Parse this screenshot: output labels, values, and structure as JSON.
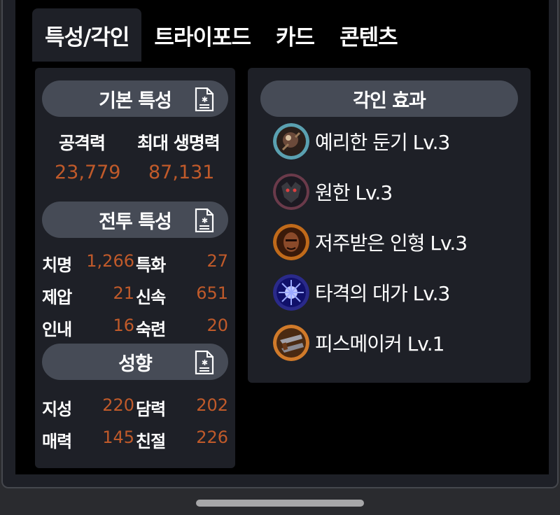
{
  "tabs": [
    {
      "label": "특성/각인",
      "active": true
    },
    {
      "label": "트라이포드",
      "active": false
    },
    {
      "label": "카드",
      "active": false
    },
    {
      "label": "콘텐츠",
      "active": false
    }
  ],
  "basic": {
    "title": "기본 특성",
    "attack_label": "공격력",
    "attack_value": "23,779",
    "hp_label": "최대 생명력",
    "hp_value": "87,131"
  },
  "combat": {
    "title": "전투 특성",
    "rows": [
      {
        "l1": "치명",
        "v1": "1,266",
        "l2": "특화",
        "v2": "27"
      },
      {
        "l1": "제압",
        "v1": "21",
        "l2": "신속",
        "v2": "651"
      },
      {
        "l1": "인내",
        "v1": "16",
        "l2": "숙련",
        "v2": "20"
      }
    ]
  },
  "tendency": {
    "title": "성향",
    "rows": [
      {
        "l1": "지성",
        "v1": "220",
        "l2": "담력",
        "v2": "202"
      },
      {
        "l1": "매력",
        "v1": "145",
        "l2": "친절",
        "v2": "226"
      }
    ]
  },
  "engravings": {
    "title": "각인 효과",
    "items": [
      {
        "name": "예리한 둔기 Lv.3",
        "icon": "blunt-weapon-icon"
      },
      {
        "name": "원한 Lv.3",
        "icon": "grudge-icon"
      },
      {
        "name": "저주받은 인형 Lv.3",
        "icon": "cursed-doll-icon"
      },
      {
        "name": "타격의 대가 Lv.3",
        "icon": "hit-master-icon"
      },
      {
        "name": "피스메이커 Lv.1",
        "icon": "peacemaker-icon"
      }
    ]
  },
  "colors": {
    "value_orange": "#c05a2a",
    "panel_bg": "#1e2027",
    "pill_bg": "#464b56"
  }
}
